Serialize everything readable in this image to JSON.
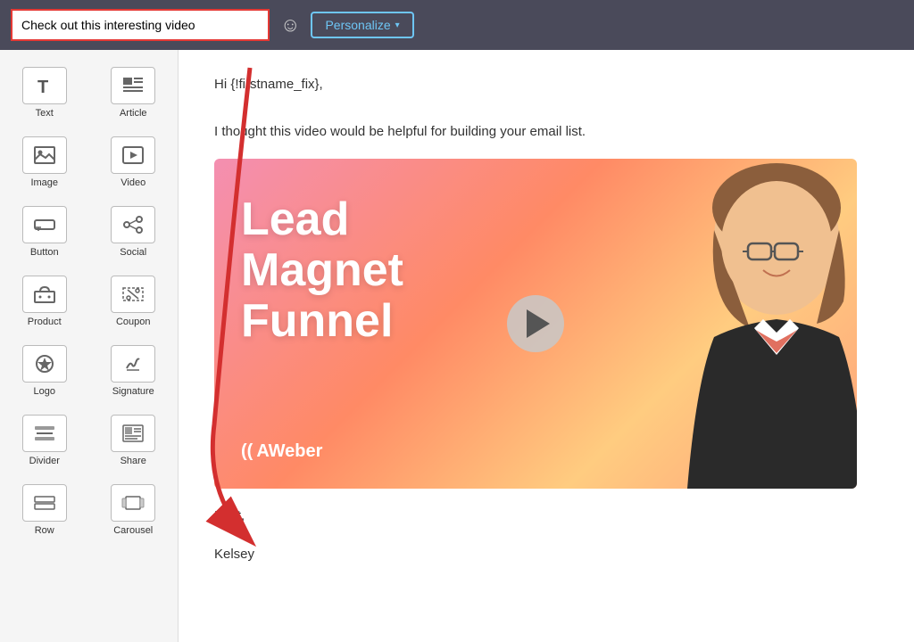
{
  "topbar": {
    "subject": "Check out this interesting video",
    "emoji_label": "☺",
    "personalize_label": "Personalize",
    "personalize_chevron": "▾"
  },
  "sidebar": {
    "items": [
      {
        "id": "text",
        "label": "Text",
        "icon": "T"
      },
      {
        "id": "article",
        "label": "Article",
        "icon": "📰"
      },
      {
        "id": "image",
        "label": "Image",
        "icon": "🖼"
      },
      {
        "id": "video",
        "label": "Video",
        "icon": "▶"
      },
      {
        "id": "button",
        "label": "Button",
        "icon": "⬛"
      },
      {
        "id": "social",
        "label": "Social",
        "icon": "✂"
      },
      {
        "id": "product",
        "label": "Product",
        "icon": "🛒"
      },
      {
        "id": "coupon",
        "label": "Coupon",
        "icon": "✂"
      },
      {
        "id": "logo",
        "label": "Logo",
        "icon": "★"
      },
      {
        "id": "signature",
        "label": "Signature",
        "icon": "✏"
      },
      {
        "id": "divider",
        "label": "Divider",
        "icon": "☰"
      },
      {
        "id": "share",
        "label": "Share",
        "icon": "📰"
      },
      {
        "id": "row",
        "label": "Row",
        "icon": "⬜"
      },
      {
        "id": "carousel",
        "label": "Carousel",
        "icon": "⬜"
      }
    ]
  },
  "email": {
    "greeting": "Hi {!firstname_fix},",
    "body": "I thought this video would be helpful for building your email list.",
    "video_title_line1": "Lead",
    "video_title_line2": "Magnet",
    "video_title_line3": "Funnel",
    "aweber_brand": "((AWeber",
    "closing": "Best,",
    "signature": "Kelsey"
  }
}
